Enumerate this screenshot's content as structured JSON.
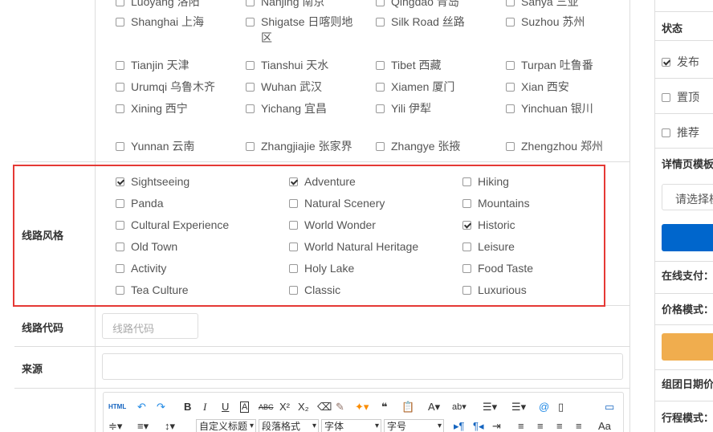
{
  "cities": [
    {
      "label": "Luoyang 洛阳",
      "checked": false
    },
    {
      "label": "Nanjing 南京",
      "checked": false
    },
    {
      "label": "Qingdao 青岛",
      "checked": false
    },
    {
      "label": "Sanya 三亚",
      "checked": false
    },
    {
      "label": "Shanghai 上海",
      "checked": false
    },
    {
      "label": "Shigatse 日喀则地区",
      "checked": false
    },
    {
      "label": "Silk Road 丝路",
      "checked": false
    },
    {
      "label": "Suzhou 苏州",
      "checked": false
    },
    {
      "label": "Tianjin 天津",
      "checked": false
    },
    {
      "label": "Tianshui 天水",
      "checked": false
    },
    {
      "label": "Tibet 西藏",
      "checked": false
    },
    {
      "label": "Turpan 吐鲁番",
      "checked": false
    },
    {
      "label": "Urumqi 乌鲁木齐",
      "checked": false
    },
    {
      "label": "Wuhan 武汉",
      "checked": false
    },
    {
      "label": "Xiamen 厦门",
      "checked": false
    },
    {
      "label": "Xian 西安",
      "checked": false
    },
    {
      "label": "Xining 西宁",
      "checked": false
    },
    {
      "label": "Yichang 宜昌",
      "checked": false
    },
    {
      "label": "Yili 伊犁",
      "checked": false
    },
    {
      "label": "Yinchuan 银川",
      "checked": false
    },
    {
      "label": "Yunnan 云南",
      "checked": false
    },
    {
      "label": "Zhangjiajie 张家界",
      "checked": false
    },
    {
      "label": "Zhangye 张掖",
      "checked": false
    },
    {
      "label": "Zhengzhou 郑州",
      "checked": false
    }
  ],
  "style_section": {
    "label": "线路风格",
    "options": [
      {
        "label": "Sightseeing",
        "checked": true
      },
      {
        "label": "Adventure",
        "checked": true
      },
      {
        "label": "Hiking",
        "checked": false
      },
      {
        "label": "Panda",
        "checked": false
      },
      {
        "label": "Natural Scenery",
        "checked": false
      },
      {
        "label": "Mountains",
        "checked": false
      },
      {
        "label": "Cultural Experience",
        "checked": false
      },
      {
        "label": "World Wonder",
        "checked": false
      },
      {
        "label": "Historic",
        "checked": true
      },
      {
        "label": "Old Town",
        "checked": false
      },
      {
        "label": "World Natural Heritage",
        "checked": false
      },
      {
        "label": "Leisure",
        "checked": false
      },
      {
        "label": "Activity",
        "checked": false
      },
      {
        "label": "Holy Lake",
        "checked": false
      },
      {
        "label": "Food Taste",
        "checked": false
      },
      {
        "label": "Tea Culture",
        "checked": false
      },
      {
        "label": "Classic",
        "checked": false
      },
      {
        "label": "Luxurious",
        "checked": false
      }
    ]
  },
  "code_row": {
    "label": "线路代码",
    "placeholder": "线路代码"
  },
  "source_row": {
    "label": "来源",
    "value": ""
  },
  "editor": {
    "html_label": "HTML",
    "custom_title": "自定义标题",
    "paragraph_format": "段落格式",
    "font": "字体",
    "font_size": "字号"
  },
  "sidebar": {
    "status_label": "状态",
    "publish": {
      "label": "发布",
      "checked": true
    },
    "top": {
      "label": "置顶",
      "checked": false
    },
    "recommend": {
      "label": "推荐",
      "checked": false
    },
    "detail_template_label": "详情页模板",
    "template_placeholder": "请选择模板",
    "online_pay_label": "在线支付：",
    "price_mode_label": "价格模式：",
    "group_date_label": "组团日期价",
    "itinerary_mode_label": "行程模式：",
    "primary_color": "#0066cc",
    "warning_color": "#f0ad4e"
  }
}
